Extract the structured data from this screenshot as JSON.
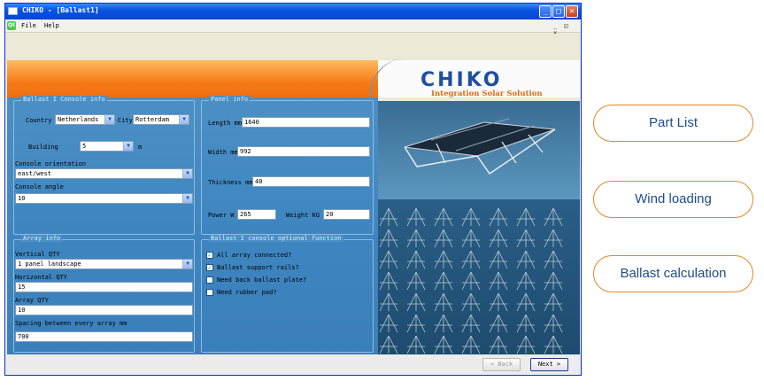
{
  "window": {
    "title": "CHIKO - [Ballast1]",
    "min_glyph": "_",
    "max_glyph": "□",
    "close_glyph": "✕"
  },
  "menu": {
    "icon_text": "Qt",
    "file": "File",
    "help": "Help",
    "mdi_controls": "_ ◱ ×"
  },
  "logo": {
    "brand": "CHIKO",
    "tagline": "Integration Solar Solution"
  },
  "console_info": {
    "title": "Ballast I Console info",
    "country_label": "Country",
    "country_value": "Netherlands",
    "city_label": "City",
    "city_value": "Rotterdam",
    "building_label": "Building",
    "building_value": "5",
    "building_unit": "m",
    "orientation_label": "Console orientation",
    "orientation_value": "east/west",
    "angle_label": "Console angle",
    "angle_value": "10"
  },
  "panel_info": {
    "title": "Panel info",
    "length_label": "Length mm",
    "length_value": "1640",
    "width_label": "Width mm",
    "width_value": "992",
    "thickness_label": "Thickness mm",
    "thickness_value": "40",
    "power_label": "Power W",
    "power_value": "265",
    "weight_label": "Weight KG",
    "weight_value": "20"
  },
  "array_info": {
    "title": "Array info",
    "vertical_label": "Vertical QTY",
    "vertical_value": "1 panel landscape",
    "horizontal_label": "Horizontal QTY",
    "horizontal_value": "15",
    "array_qty_label": "Array QTY",
    "array_qty_value": "10",
    "spacing_label": "Spacing between every array mm",
    "spacing_value": "700"
  },
  "optional": {
    "title": "Ballast I console optional function",
    "items": [
      {
        "label": "All array connected?",
        "checked": true
      },
      {
        "label": "Ballast support rails?",
        "checked": true
      },
      {
        "label": "Need back ballast plate?",
        "checked": false
      },
      {
        "label": "Need rubber pad?",
        "checked": false
      }
    ]
  },
  "nav": {
    "back": "< Back",
    "next": "Next >"
  },
  "side_buttons": {
    "part_list": "Part List",
    "wind_loading": "Wind loading",
    "ballast_calculation": "Ballast calculation"
  },
  "icons": {
    "dropdown": "chevron-down-icon",
    "check": "check-icon",
    "app": "app-window-icon"
  },
  "colors": {
    "titlebar": "#0a54e3",
    "orange": "#f57b17",
    "panel_blue": "#4b8fc4",
    "brand_blue": "#1f4fa2",
    "pill_border": "#e0872a"
  }
}
